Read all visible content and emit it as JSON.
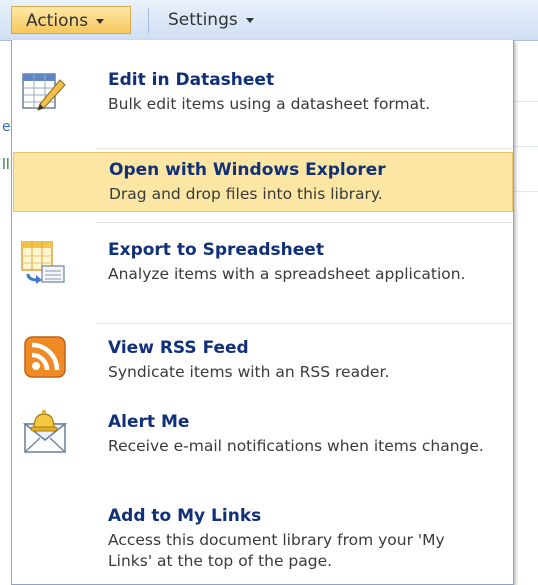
{
  "toolbar": {
    "actions_label": "Actions",
    "settings_label": "Settings"
  },
  "menu": {
    "items": [
      {
        "title": "Edit in Datasheet",
        "desc": "Bulk edit items using a datasheet format.",
        "icon": "datasheet-edit-icon"
      },
      {
        "title": "Open with Windows Explorer",
        "desc": "Drag and drop files into this library.",
        "icon": "",
        "highlighted": true
      },
      {
        "title": "Export to Spreadsheet",
        "desc": "Analyze items with a spreadsheet application.",
        "icon": "export-spreadsheet-icon"
      },
      {
        "title": "View RSS Feed",
        "desc": "Syndicate items with an RSS reader.",
        "icon": "rss-icon"
      },
      {
        "title": "Alert Me",
        "desc": "Receive e-mail notifications when items change.",
        "icon": "alert-envelope-icon"
      },
      {
        "title": "Add to My Links",
        "desc": "Access this document library from your 'My Links' at the top of the page.",
        "icon": ""
      }
    ]
  },
  "colors": {
    "toolbar_bg": "#cfdff3",
    "highlight_bg": "#fbe6a3",
    "title_color": "#10307a",
    "rss_orange": "#f08a24"
  }
}
